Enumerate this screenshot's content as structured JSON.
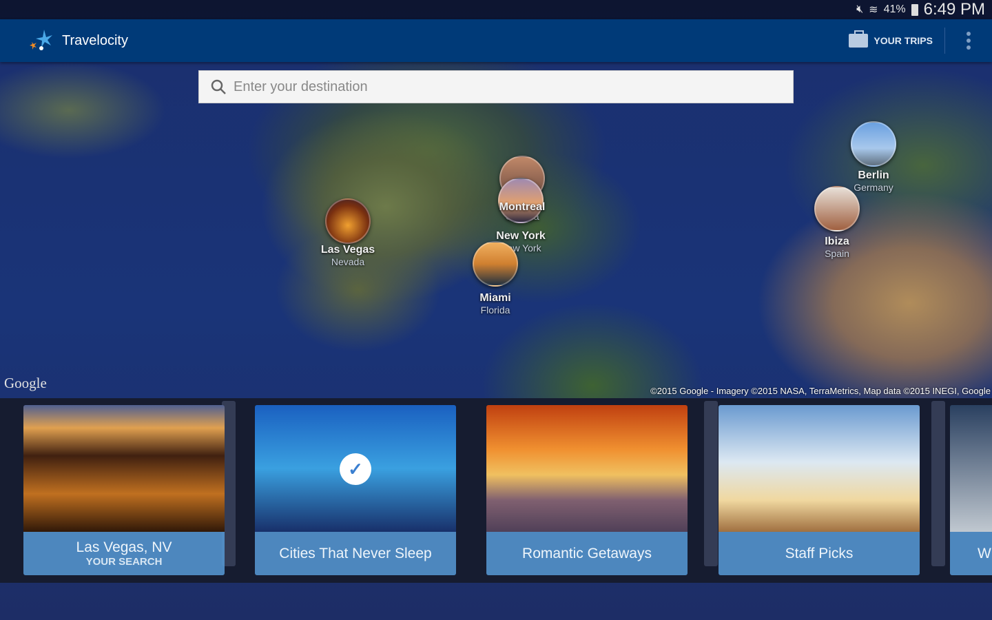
{
  "status_bar": {
    "battery": "41%",
    "time": "6:49 PM"
  },
  "app_bar": {
    "title": "Travelocity",
    "your_trips": "YOUR TRIPS"
  },
  "search": {
    "placeholder": "Enter your destination"
  },
  "pins": [
    {
      "city": "Las Vegas",
      "region": "Nevada"
    },
    {
      "city": "Montreal",
      "region": "Canada"
    },
    {
      "city": "New York",
      "region": "New York"
    },
    {
      "city": "Miami",
      "region": "Florida"
    },
    {
      "city": "Berlin",
      "region": "Germany"
    },
    {
      "city": "Ibiza",
      "region": "Spain"
    }
  ],
  "map": {
    "google_logo": "Google",
    "copyright": "©2015 Google - Imagery ©2015 NASA, TerraMetrics, Map data ©2015 INEGI, Google"
  },
  "cards": [
    {
      "title": "Las Vegas, NV",
      "subtitle": "YOUR SEARCH"
    },
    {
      "title": "Cities That Never Sleep",
      "selected": true
    },
    {
      "title": "Romantic Getaways"
    },
    {
      "title": "Staff Picks"
    },
    {
      "title": "W"
    }
  ]
}
